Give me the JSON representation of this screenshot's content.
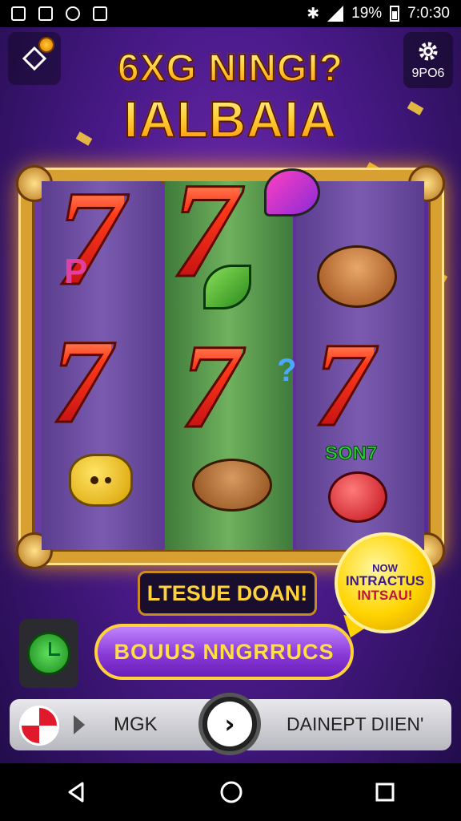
{
  "status_bar": {
    "battery_text": "19%",
    "time": "7:0:30",
    "time_display": "7:0:30"
  },
  "header": {
    "title_line1": "6XG NINGI?",
    "title_line2": "IALBAIA",
    "settings_label": "9PO6"
  },
  "reels": {
    "reel1": [
      "7",
      "7",
      "cookie"
    ],
    "reel2": [
      "7",
      "7",
      "burger"
    ],
    "reel3": [
      "bun",
      "7",
      "apple"
    ],
    "reel1_side_text": "P",
    "reel3_bottom_text": "SON7"
  },
  "win_banner": "LTESUE DOAN!",
  "badge": {
    "line1": "NOW",
    "line2": "INTRACTUS",
    "line3": "INTSAU!"
  },
  "bonus_button": "BOUUS NNGRRUCS",
  "bottom_bar": {
    "left_label": "MGK",
    "right_label": "DAINEPT DIIEN'"
  },
  "colors": {
    "accent_gold": "#d8a030",
    "bonus_purple": "#8a3ad8",
    "title_yellow": "#ffd23b"
  }
}
